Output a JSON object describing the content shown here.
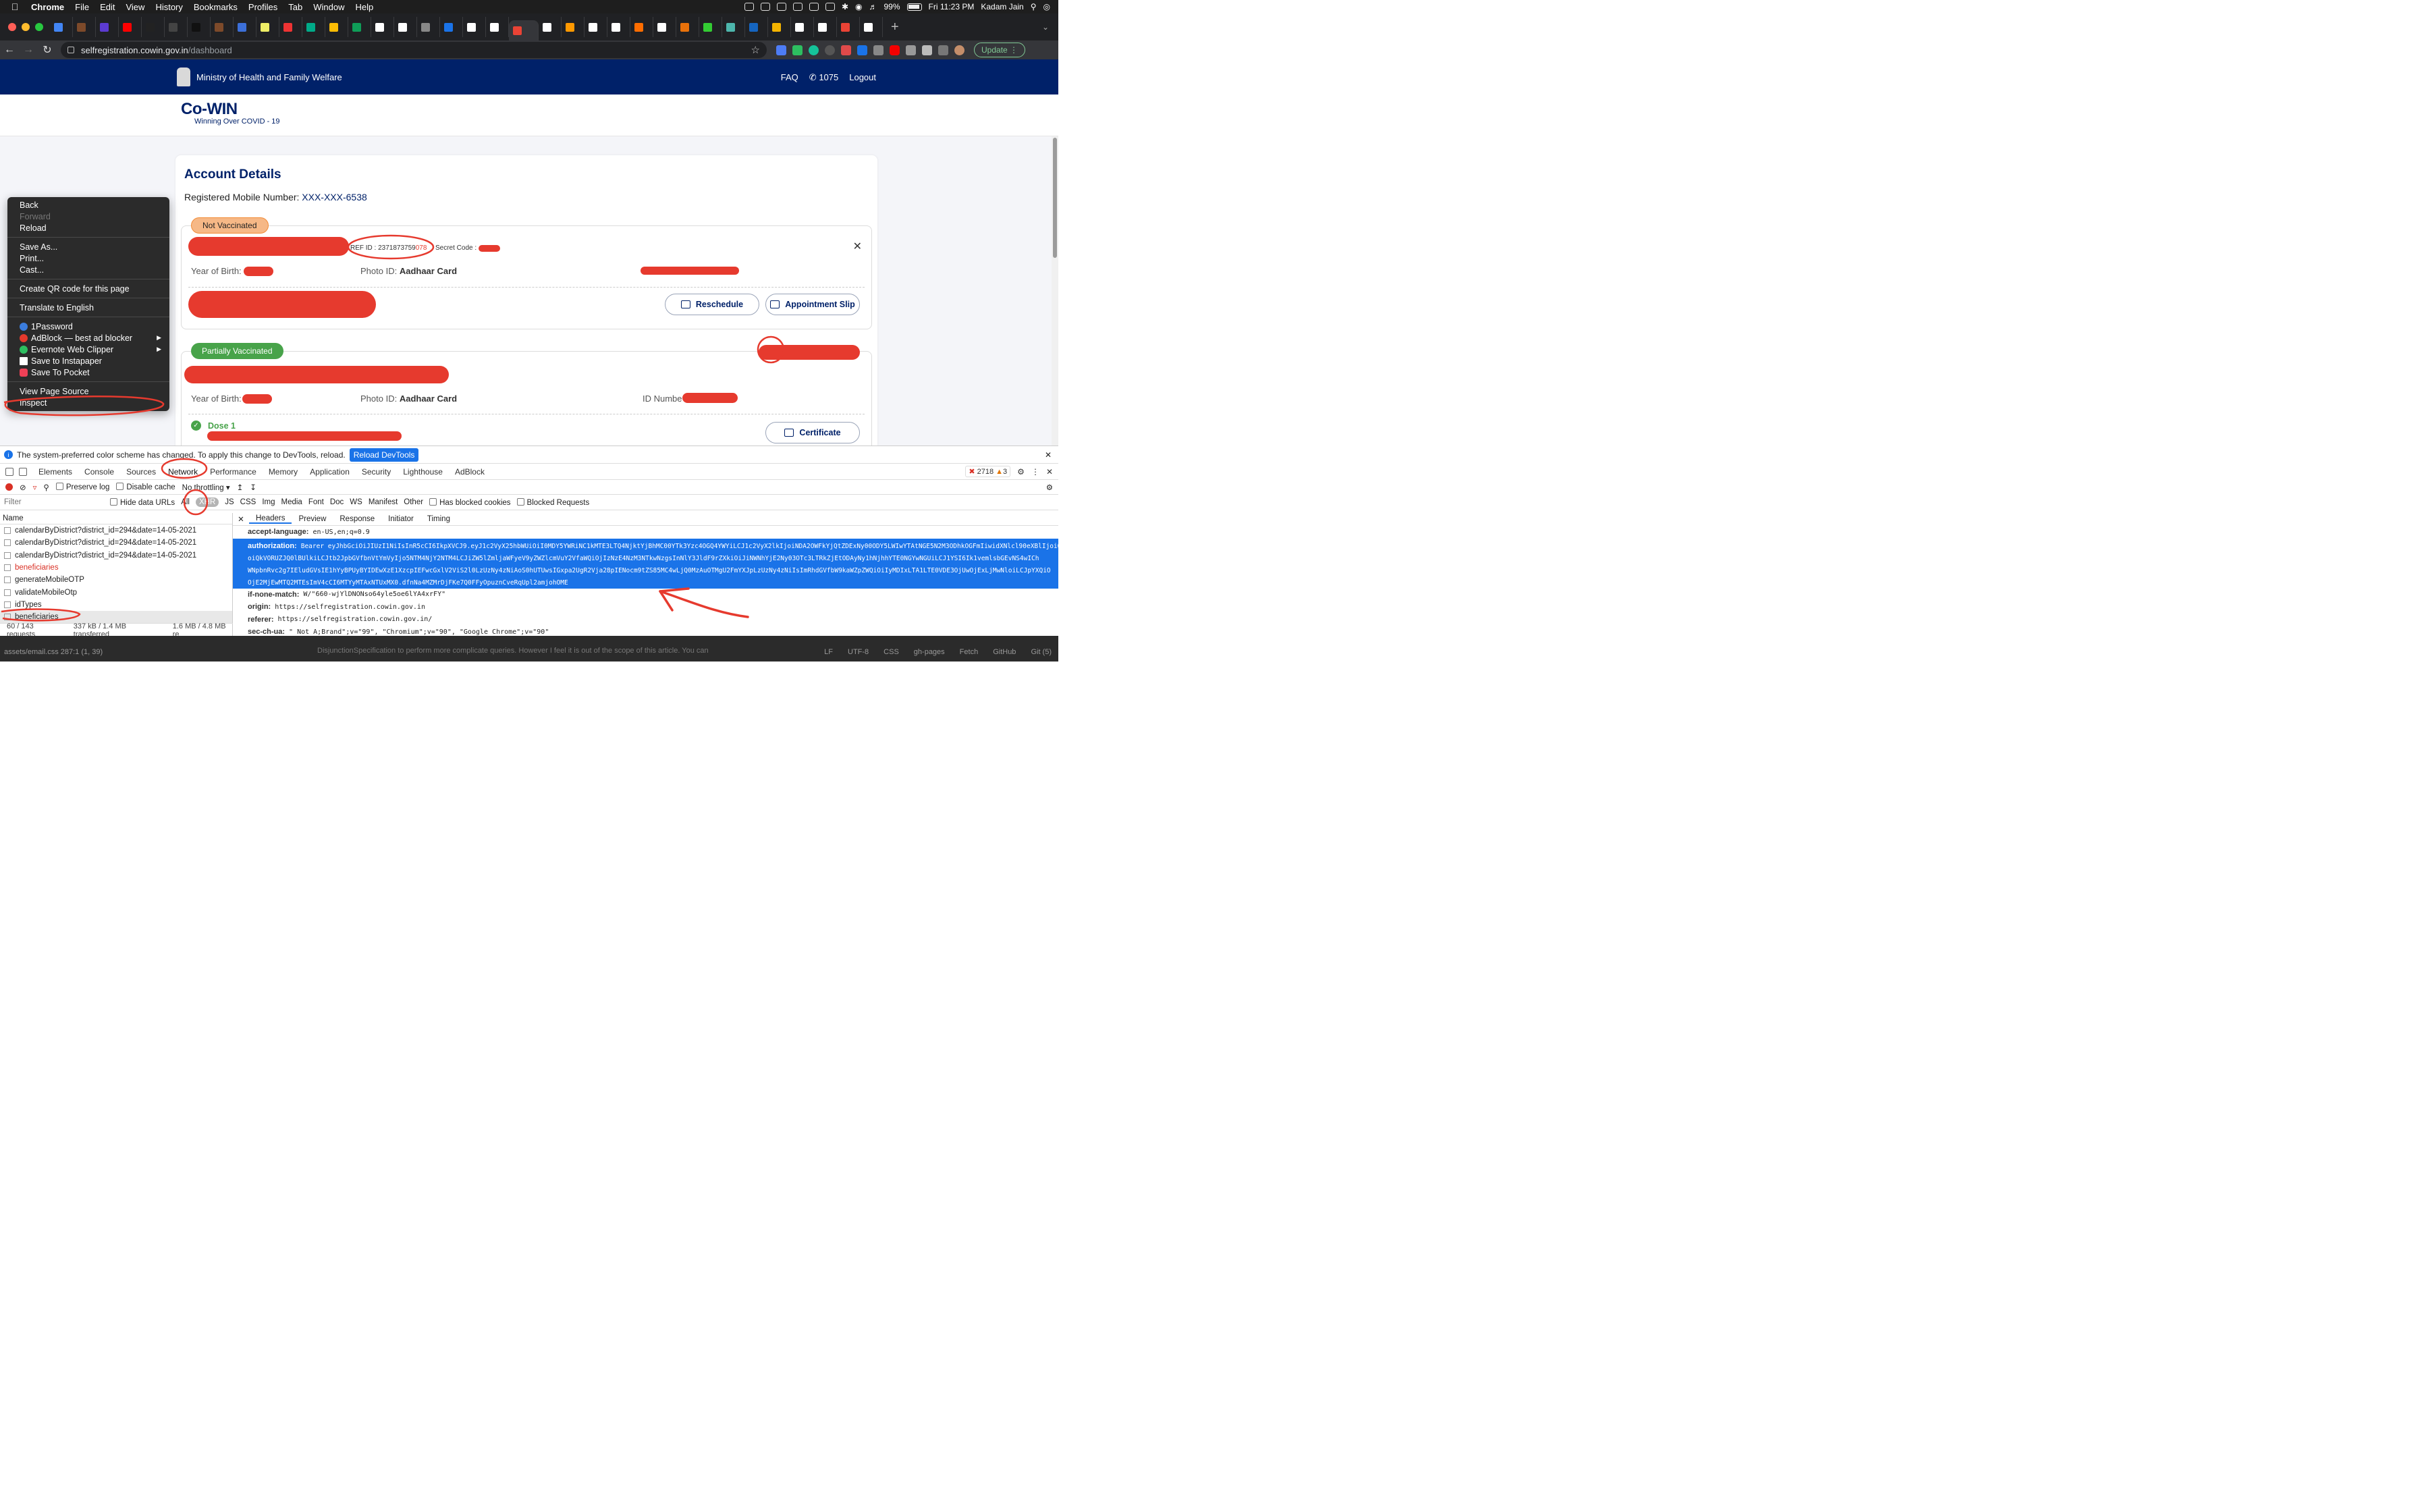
{
  "menubar": {
    "app": "Chrome",
    "items": [
      "File",
      "Edit",
      "View",
      "History",
      "Bookmarks",
      "Profiles",
      "Tab",
      "Window",
      "Help"
    ],
    "battery": "99%",
    "datetime": "Fri 11:23 PM",
    "user": "Kadam Jain"
  },
  "browser": {
    "url_domain": "selfregistration.cowin.gov.in",
    "url_path": "/dashboard",
    "update_label": "Update"
  },
  "site": {
    "ministry": "Ministry of Health and Family Welfare",
    "faq": "FAQ",
    "helpline": "1075",
    "logout": "Logout",
    "logo": "Co-WIN",
    "tagline": "Winning Over COVID - 19"
  },
  "account": {
    "title": "Account Details",
    "mobile_label": "Registered Mobile Number:",
    "mobile": "XXX-XXX-6538"
  },
  "beneficiary1": {
    "status": "Not Vaccinated",
    "ref_prefix": "REF ID : 2371873759",
    "ref_suffix": "078",
    "secret_label": "Secret Code :",
    "yob_label": "Year of Birth:",
    "photo_label": "Photo ID:",
    "photo_value": "Aadhaar Card",
    "reschedule": "Reschedule",
    "appointment": "Appointment Slip"
  },
  "beneficiary2": {
    "status": "Partially Vaccinated",
    "yob_label": "Year of Birth:",
    "photo_label": "Photo ID:",
    "photo_value": "Aadhaar Card",
    "id_label": "ID Numbe",
    "dose": "Dose 1",
    "certificate": "Certificate"
  },
  "context_menu": {
    "back": "Back",
    "forward": "Forward",
    "reload": "Reload",
    "save_as": "Save As...",
    "print": "Print...",
    "cast": "Cast...",
    "qr": "Create QR code for this page",
    "translate": "Translate to English",
    "onepassword": "1Password",
    "adblock": "AdBlock — best ad blocker",
    "evernote": "Evernote Web Clipper",
    "instapaper": "Save to Instapaper",
    "pocket": "Save To Pocket",
    "view_source": "View Page Source",
    "inspect": "Inspect"
  },
  "devtools": {
    "info_text": "The system-preferred color scheme has changed. To apply this change to DevTools, reload.",
    "reload_devtools": "Reload DevTools",
    "tabs": [
      "Elements",
      "Console",
      "Sources",
      "Network",
      "Performance",
      "Memory",
      "Application",
      "Security",
      "Lighthouse",
      "AdBlock"
    ],
    "errors": "2718",
    "warnings": "3",
    "preserve_log": "Preserve log",
    "disable_cache": "Disable cache",
    "throttling": "No throttling",
    "filter_placeholder": "Filter",
    "hide_data_urls": "Hide data URLs",
    "filter_types": [
      "All",
      "XHR",
      "JS",
      "CSS",
      "Img",
      "Media",
      "Font",
      "Doc",
      "WS",
      "Manifest",
      "Other"
    ],
    "blocked_cookies": "Has blocked cookies",
    "blocked_requests": "Blocked Requests",
    "name_header": "Name",
    "requests": [
      {
        "name": "calendarByDistrict?district_id=294&date=14-05-2021",
        "error": false
      },
      {
        "name": "calendarByDistrict?district_id=294&date=14-05-2021",
        "error": false
      },
      {
        "name": "calendarByDistrict?district_id=294&date=14-05-2021",
        "error": false
      },
      {
        "name": "beneficiaries",
        "error": true
      },
      {
        "name": "generateMobileOTP",
        "error": false
      },
      {
        "name": "validateMobileOtp",
        "error": false
      },
      {
        "name": "idTypes",
        "error": false
      },
      {
        "name": "beneficiaries",
        "error": false
      }
    ],
    "status_requests": "60 / 143 requests",
    "status_transferred": "337 kB / 1.4 MB transferred",
    "status_resources": "1.6 MB / 4.8 MB re",
    "detail_tabs": [
      "Headers",
      "Preview",
      "Response",
      "Initiator",
      "Timing"
    ],
    "headers": {
      "accept_language_k": "accept-language:",
      "accept_language_v": "en-US,en;q=0.9",
      "authorization_k": "authorization:",
      "authorization_v1": "Bearer eyJhbGciOiJIUzI1NiIsInR5cCI6IkpXVCJ9.eyJ1c2VyX25hbWUiOiI0MDY5YWRiNC1kMTE3LTQ4NjktYjBhMC00YTk3Yzc4OGQ4YWYiLCJ1c2VyX2lkIjoiNDA2OWFkYjQtZDExNy00ODY5LWIwYTAtNGE5N2M3ODhkOGFmIiwidXNlcl90eXBlIjoiQkVORUZJQ0lBUlkiLCJtb2JpbGVfbnVtYmVyIjo5NTM4NjY2NTM4LCJiZW5lZmljaWFyeV9yZWZlcmVuY2VfaWQiOjIzNzE4NzM3NTkwNzgsInNlY3JldF9rZXkiOiJ",
      "authorization_v2": "oiQkVORUZJQ0lBUlkiLCJtb2JpbGVfbnVtYmVyIjo5NTM4NjY2NTM4LCJiZW5lZmljaWFyeV9yZWZlcmVuY2VfaWQiOjIzNzE4NzM3NTkwNzgsInNlY3JldF9rZXkiOiJiNWNhYjE2Ny03OTc3LTRkZjEtODAyNy1hNjhhYTE0NGYwNGUiLCJ1YSI6Ik1vemlsbGEvNS4wICh",
      "authorization_v3": "WNpbnRvc2g7IEludGVsIE1hYyBPUyBYIDEwXzE1XzcpIEFwcGxlV2ViS2l0LzUzNy4zNiAoS0hUTUwsIGxpa2UgR2Vja28pIENocm9tZS85MC4wLjQ0MzAuOTMgU2FmYXJpLzUzNy4zNiIsImRhdGVfbW9kaWZpZWQiOiIyMDIxLTA1LTE0VDE3OjUwOjExLjMwNloiLCJpYXQiO",
      "authorization_v4": "OjE2MjEwMTQ2MTEsImV4cCI6MTYyMTAxNTUxMX0.dfnNa4MZMrDjFKe7Q0FFyOpuznCveRqUpl2amjohOME",
      "if_none_match_k": "if-none-match:",
      "if_none_match_v": "W/\"660-wjYlDNONso64yle5oe6lYA4xrFY\"",
      "origin_k": "origin:",
      "origin_v": "https://selfregistration.cowin.gov.in",
      "referer_k": "referer:",
      "referer_v": "https://selfregistration.cowin.gov.in/",
      "sec_ch_ua_k": "sec-ch-ua:",
      "sec_ch_ua_v": "\" Not A;Brand\";v=\"99\", \"Chromium\";v=\"90\", \"Google Chrome\";v=\"90\""
    }
  },
  "editor_status": {
    "left": "assets/email.css  287:1  (1, 39)",
    "middle": "DisjunctionSpecification to perform more complicate queries. However I feel it is out of the scope of this article. You can",
    "right": [
      "LF",
      "UTF-8",
      "CSS",
      "gh-pages",
      "Fetch",
      "GitHub",
      "Git (5)"
    ]
  },
  "colors": {
    "gov_navy": "#002169",
    "annotation_red": "#e63a2e",
    "selection_blue": "#1a73e8",
    "success_green": "#48a34a"
  }
}
